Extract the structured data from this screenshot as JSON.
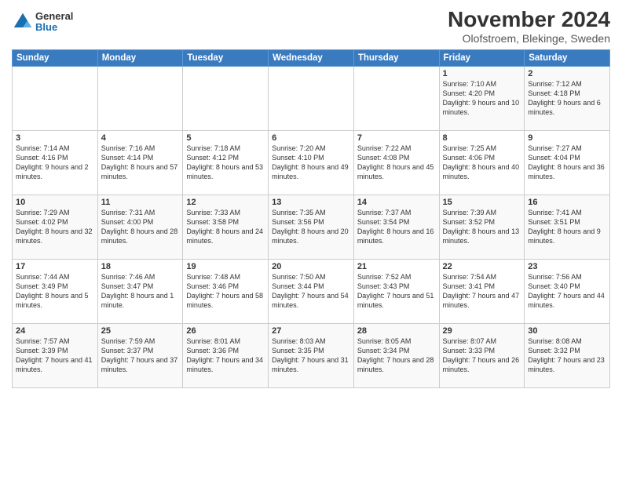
{
  "logo": {
    "general": "General",
    "blue": "Blue"
  },
  "header": {
    "month": "November 2024",
    "location": "Olofstroem, Blekinge, Sweden"
  },
  "weekdays": [
    "Sunday",
    "Monday",
    "Tuesday",
    "Wednesday",
    "Thursday",
    "Friday",
    "Saturday"
  ],
  "weeks": [
    [
      {
        "day": "",
        "info": ""
      },
      {
        "day": "",
        "info": ""
      },
      {
        "day": "",
        "info": ""
      },
      {
        "day": "",
        "info": ""
      },
      {
        "day": "",
        "info": ""
      },
      {
        "day": "1",
        "info": "Sunrise: 7:10 AM\nSunset: 4:20 PM\nDaylight: 9 hours and 10 minutes."
      },
      {
        "day": "2",
        "info": "Sunrise: 7:12 AM\nSunset: 4:18 PM\nDaylight: 9 hours and 6 minutes."
      }
    ],
    [
      {
        "day": "3",
        "info": "Sunrise: 7:14 AM\nSunset: 4:16 PM\nDaylight: 9 hours and 2 minutes."
      },
      {
        "day": "4",
        "info": "Sunrise: 7:16 AM\nSunset: 4:14 PM\nDaylight: 8 hours and 57 minutes."
      },
      {
        "day": "5",
        "info": "Sunrise: 7:18 AM\nSunset: 4:12 PM\nDaylight: 8 hours and 53 minutes."
      },
      {
        "day": "6",
        "info": "Sunrise: 7:20 AM\nSunset: 4:10 PM\nDaylight: 8 hours and 49 minutes."
      },
      {
        "day": "7",
        "info": "Sunrise: 7:22 AM\nSunset: 4:08 PM\nDaylight: 8 hours and 45 minutes."
      },
      {
        "day": "8",
        "info": "Sunrise: 7:25 AM\nSunset: 4:06 PM\nDaylight: 8 hours and 40 minutes."
      },
      {
        "day": "9",
        "info": "Sunrise: 7:27 AM\nSunset: 4:04 PM\nDaylight: 8 hours and 36 minutes."
      }
    ],
    [
      {
        "day": "10",
        "info": "Sunrise: 7:29 AM\nSunset: 4:02 PM\nDaylight: 8 hours and 32 minutes."
      },
      {
        "day": "11",
        "info": "Sunrise: 7:31 AM\nSunset: 4:00 PM\nDaylight: 8 hours and 28 minutes."
      },
      {
        "day": "12",
        "info": "Sunrise: 7:33 AM\nSunset: 3:58 PM\nDaylight: 8 hours and 24 minutes."
      },
      {
        "day": "13",
        "info": "Sunrise: 7:35 AM\nSunset: 3:56 PM\nDaylight: 8 hours and 20 minutes."
      },
      {
        "day": "14",
        "info": "Sunrise: 7:37 AM\nSunset: 3:54 PM\nDaylight: 8 hours and 16 minutes."
      },
      {
        "day": "15",
        "info": "Sunrise: 7:39 AM\nSunset: 3:52 PM\nDaylight: 8 hours and 13 minutes."
      },
      {
        "day": "16",
        "info": "Sunrise: 7:41 AM\nSunset: 3:51 PM\nDaylight: 8 hours and 9 minutes."
      }
    ],
    [
      {
        "day": "17",
        "info": "Sunrise: 7:44 AM\nSunset: 3:49 PM\nDaylight: 8 hours and 5 minutes."
      },
      {
        "day": "18",
        "info": "Sunrise: 7:46 AM\nSunset: 3:47 PM\nDaylight: 8 hours and 1 minute."
      },
      {
        "day": "19",
        "info": "Sunrise: 7:48 AM\nSunset: 3:46 PM\nDaylight: 7 hours and 58 minutes."
      },
      {
        "day": "20",
        "info": "Sunrise: 7:50 AM\nSunset: 3:44 PM\nDaylight: 7 hours and 54 minutes."
      },
      {
        "day": "21",
        "info": "Sunrise: 7:52 AM\nSunset: 3:43 PM\nDaylight: 7 hours and 51 minutes."
      },
      {
        "day": "22",
        "info": "Sunrise: 7:54 AM\nSunset: 3:41 PM\nDaylight: 7 hours and 47 minutes."
      },
      {
        "day": "23",
        "info": "Sunrise: 7:56 AM\nSunset: 3:40 PM\nDaylight: 7 hours and 44 minutes."
      }
    ],
    [
      {
        "day": "24",
        "info": "Sunrise: 7:57 AM\nSunset: 3:39 PM\nDaylight: 7 hours and 41 minutes."
      },
      {
        "day": "25",
        "info": "Sunrise: 7:59 AM\nSunset: 3:37 PM\nDaylight: 7 hours and 37 minutes."
      },
      {
        "day": "26",
        "info": "Sunrise: 8:01 AM\nSunset: 3:36 PM\nDaylight: 7 hours and 34 minutes."
      },
      {
        "day": "27",
        "info": "Sunrise: 8:03 AM\nSunset: 3:35 PM\nDaylight: 7 hours and 31 minutes."
      },
      {
        "day": "28",
        "info": "Sunrise: 8:05 AM\nSunset: 3:34 PM\nDaylight: 7 hours and 28 minutes."
      },
      {
        "day": "29",
        "info": "Sunrise: 8:07 AM\nSunset: 3:33 PM\nDaylight: 7 hours and 26 minutes."
      },
      {
        "day": "30",
        "info": "Sunrise: 8:08 AM\nSunset: 3:32 PM\nDaylight: 7 hours and 23 minutes."
      }
    ]
  ]
}
